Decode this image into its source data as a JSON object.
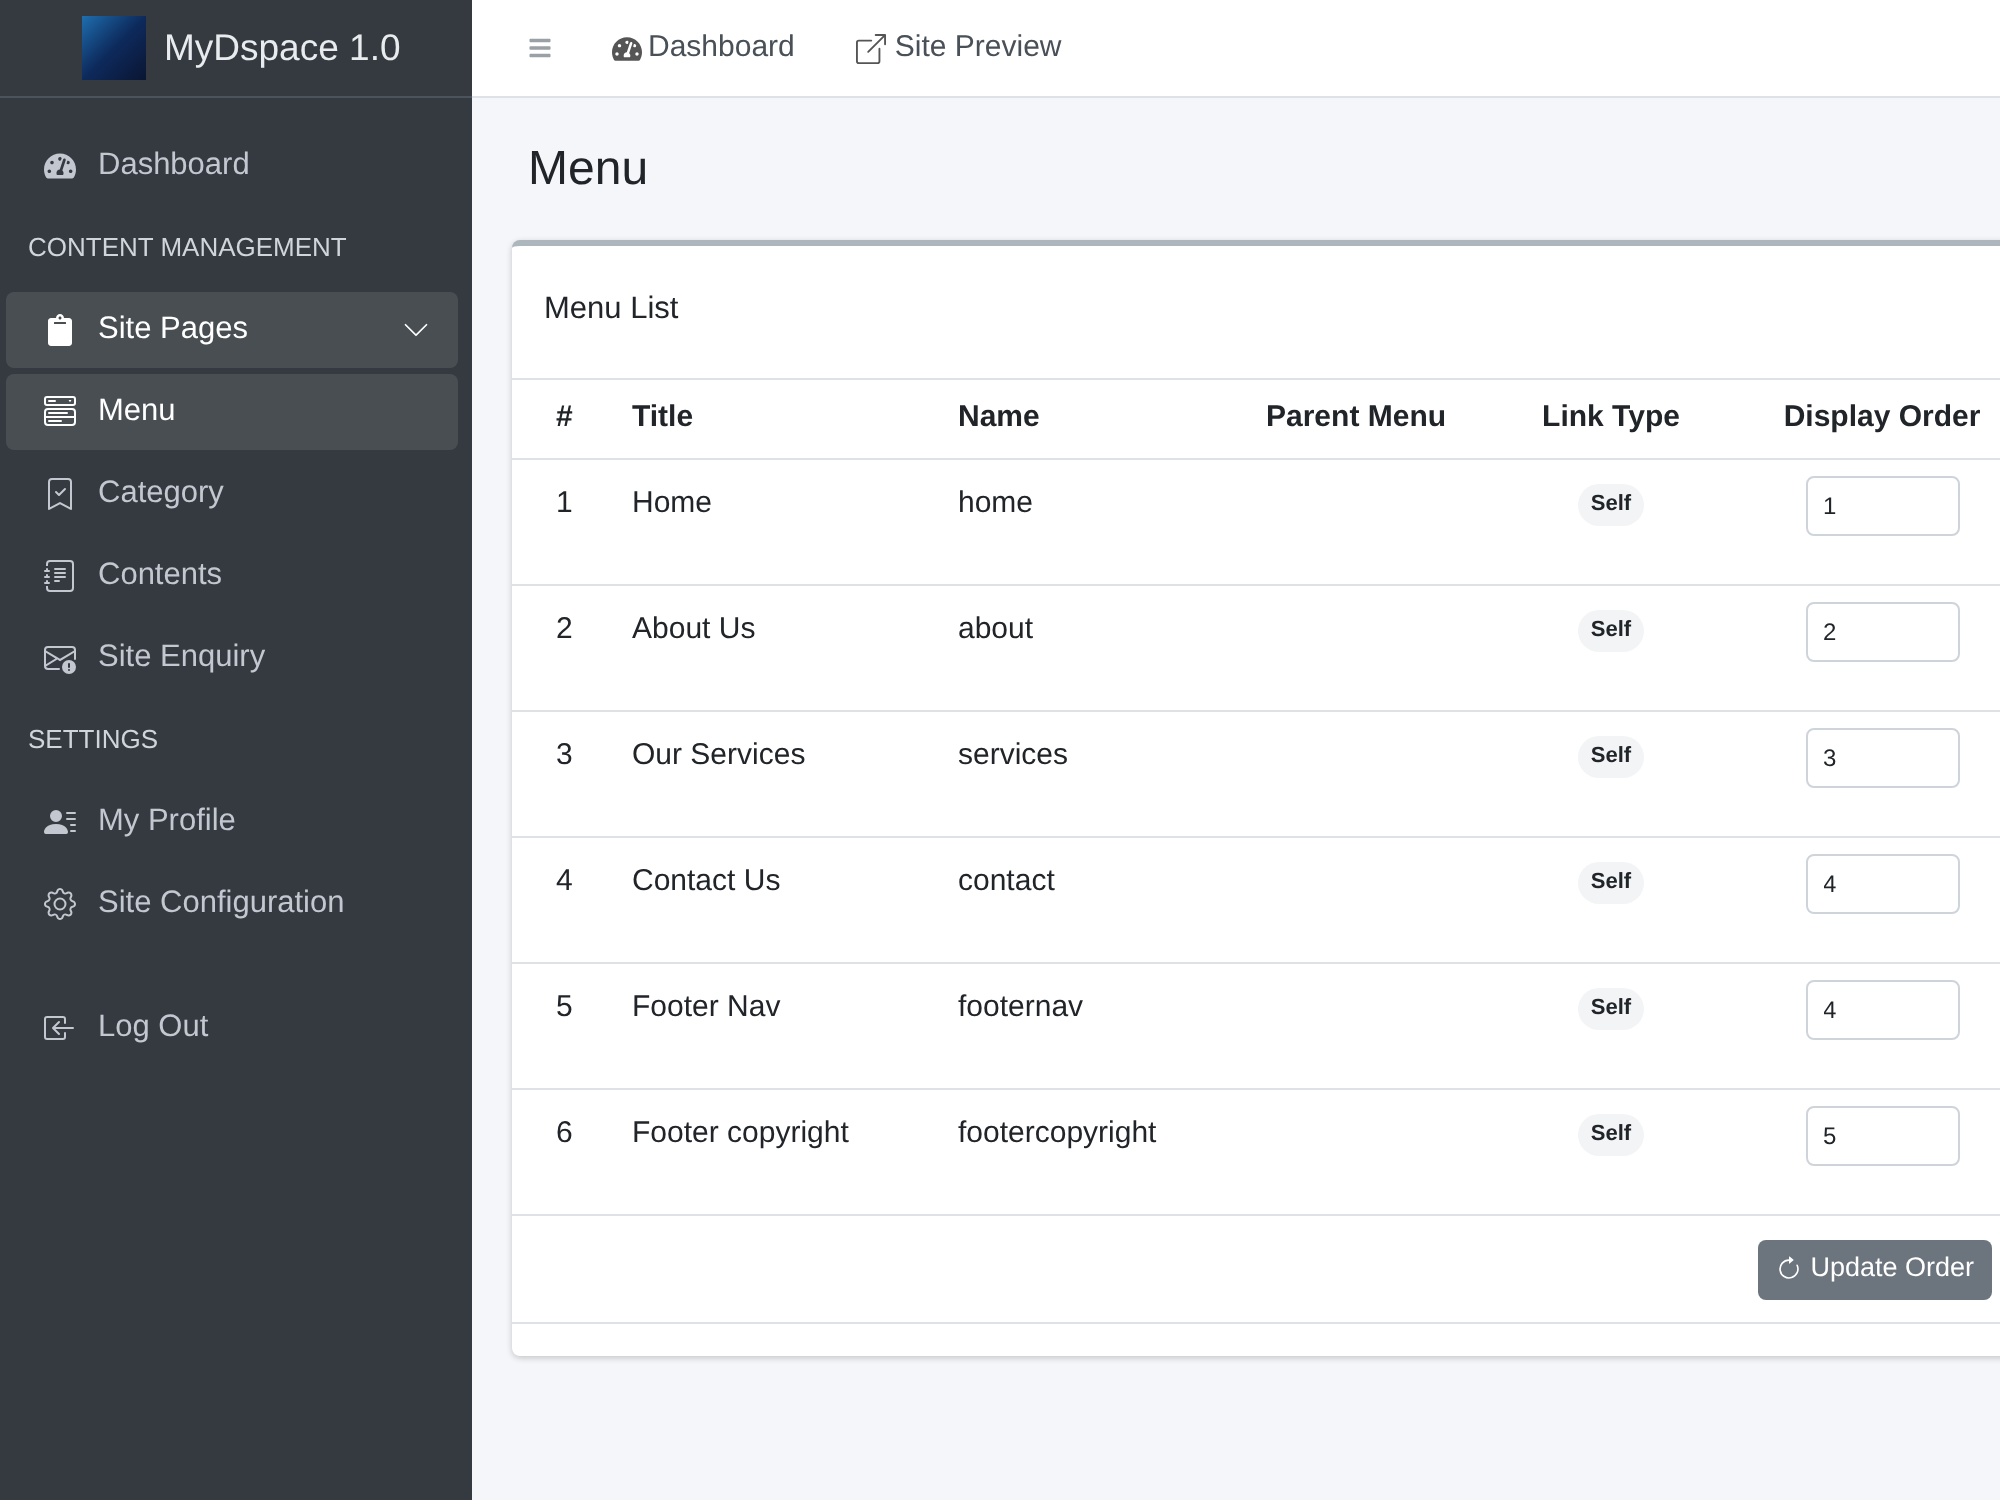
{
  "sidebar": {
    "brand": {
      "name": "MyDspace 1.0"
    },
    "sections": [
      {
        "items": [
          {
            "label": "Dashboard",
            "selected": false
          }
        ]
      },
      {
        "header": "CONTENT MANAGEMENT",
        "items": [
          {
            "label": "Site Pages",
            "selected": false,
            "expanded": true,
            "children": [
              {
                "label": "Menu",
                "selected": true
              },
              {
                "label": "Category",
                "selected": false
              },
              {
                "label": "Contents",
                "selected": false
              },
              {
                "label": "Site Enquiry",
                "selected": false
              }
            ]
          }
        ]
      },
      {
        "header": "SETTINGS",
        "items": [
          {
            "label": "My Profile",
            "selected": false
          },
          {
            "label": "Site Configuration",
            "selected": false
          }
        ]
      }
    ],
    "logout": {
      "label": "Log Out"
    }
  },
  "topbar": {
    "links": [
      "Dashboard",
      "Site Preview"
    ]
  },
  "page": {
    "title": "Menu"
  },
  "card": {
    "title": "Menu List",
    "table": {
      "columns": [
        "#",
        "Title",
        "Name",
        "Parent Menu",
        "Link Type",
        "Display Order"
      ],
      "rows": [
        {
          "index": "1",
          "title": "Home",
          "name": "home",
          "link_type": "Self",
          "display_order": "1"
        },
        {
          "index": "2",
          "title": "About Us",
          "name": "about",
          "link_type": "Self",
          "display_order": "2"
        },
        {
          "index": "3",
          "title": "Our Services",
          "name": "services",
          "link_type": "Self",
          "display_order": "3"
        },
        {
          "index": "4",
          "title": "Contact Us",
          "name": "contact",
          "link_type": "Self",
          "display_order": "4"
        },
        {
          "index": "5",
          "title": "Footer Nav",
          "name": "footernav",
          "link_type": "Self",
          "display_order": "4"
        },
        {
          "index": "6",
          "title": "Footer copyright",
          "name": "footercopyright",
          "link_type": "Self",
          "display_order": "5"
        }
      ]
    },
    "button": "Update Order"
  }
}
